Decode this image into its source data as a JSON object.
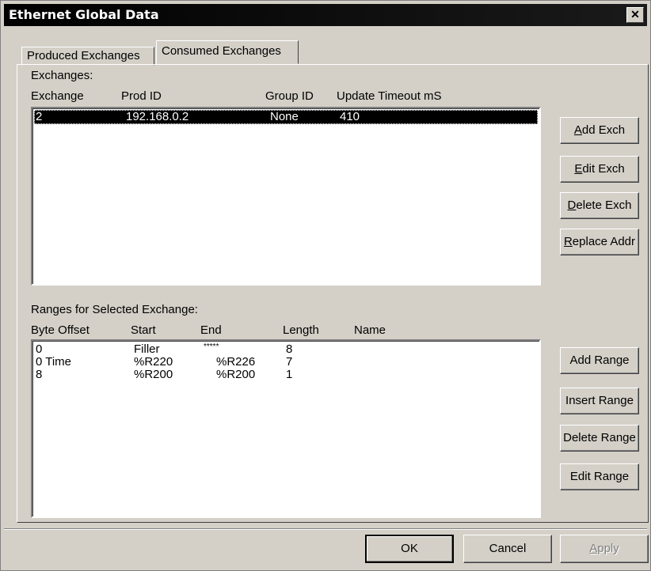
{
  "window": {
    "title": "Ethernet Global Data",
    "close_glyph": "✕"
  },
  "tabs": [
    {
      "label": "Produced Exchanges",
      "active": false
    },
    {
      "label": "Consumed Exchanges",
      "active": true
    }
  ],
  "exchanges": {
    "label": "Exchanges:",
    "columns": [
      "Exchange",
      "Prod ID",
      "Group ID",
      "Update Timeout mS"
    ],
    "rows": [
      {
        "exchange": "2",
        "prod_id": "192.168.0.2",
        "group_id": "None",
        "timeout": "410",
        "selected": true
      }
    ],
    "buttons": {
      "add": {
        "mnemonic": "A",
        "rest": "dd Exch"
      },
      "edit": {
        "mnemonic": "E",
        "rest": "dit Exch"
      },
      "delete": {
        "mnemonic": "D",
        "rest": "elete Exch"
      },
      "replace": {
        "mnemonic": "R",
        "rest": "eplace Addr"
      }
    }
  },
  "ranges": {
    "label": "Ranges for Selected Exchange:",
    "columns": [
      "Byte Offset",
      "Start",
      "End",
      "Length",
      "Name"
    ],
    "rows": [
      {
        "offset": "0",
        "start": "Filler",
        "end": "*****",
        "length": "8",
        "name": ""
      },
      {
        "offset": "0 Time",
        "start": "%R220",
        "end": "%R226",
        "length": "7",
        "name": ""
      },
      {
        "offset": "8",
        "start": "%R200",
        "end": "%R200",
        "length": "1",
        "name": ""
      }
    ],
    "buttons": {
      "add": "Add Range",
      "insert": "Insert Range",
      "delete": "Delete Range",
      "edit": "Edit Range"
    }
  },
  "footer": {
    "ok": "OK",
    "cancel": "Cancel",
    "apply": {
      "mnemonic": "A",
      "rest": "pply"
    }
  }
}
